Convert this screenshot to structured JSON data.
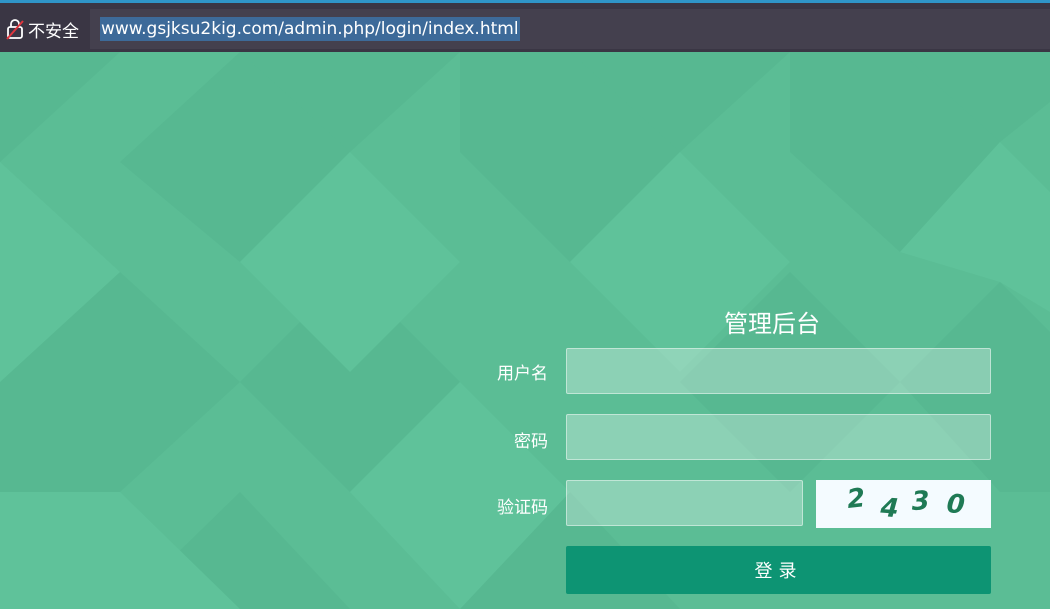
{
  "browser": {
    "security_label": "不安全",
    "url": "www.gsjksu2kig.com/admin.php/login/index.html"
  },
  "login": {
    "title": "管理后台",
    "username_label": "用户名",
    "password_label": "密码",
    "captcha_label": "验证码",
    "username_value": "",
    "password_value": "",
    "captcha_value": "",
    "captcha_code": "2430",
    "submit_label": "登录"
  },
  "colors": {
    "page_bg": "#5bbd95",
    "button": "#0d9473",
    "browser_bar": "#3a3644"
  }
}
